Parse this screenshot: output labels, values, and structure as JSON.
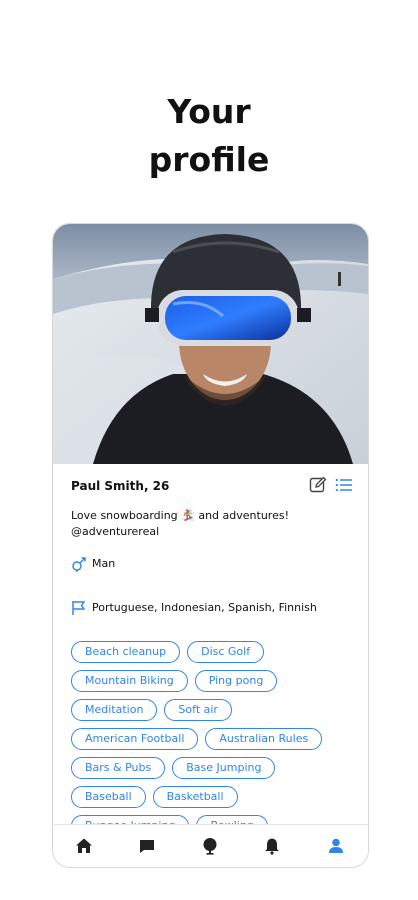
{
  "heading": {
    "line1": "Your",
    "line2": "profile"
  },
  "profile": {
    "name": "Paul Smith, 26",
    "bio_before_emoji": "Love snowboarding ",
    "bio_emoji": "🏂",
    "bio_after_emoji": " and adventures!",
    "handle": "@adventurereal",
    "gender": "Man",
    "languages": "Portuguese, Indonesian, Spanish, Finnish"
  },
  "interests": [
    [
      "Beach cleanup",
      "Disc Golf"
    ],
    [
      "Mountain Biking",
      "Ping pong"
    ],
    [
      "Meditation",
      "Soft air"
    ],
    [
      "American Football",
      "Australian Rules"
    ],
    [
      "Bars & Pubs",
      "Base Jumping"
    ],
    [
      "Baseball",
      "Basketball"
    ],
    [
      "Bungee Jumping",
      "Bowling"
    ]
  ],
  "tabs": {
    "active": "profile",
    "active_color": "#2f86e6",
    "inactive_color": "#222222",
    "icons": [
      "home-icon",
      "chat-icon",
      "explore-icon",
      "bell-icon",
      "profile-icon"
    ]
  },
  "accent": "#2f86e6"
}
